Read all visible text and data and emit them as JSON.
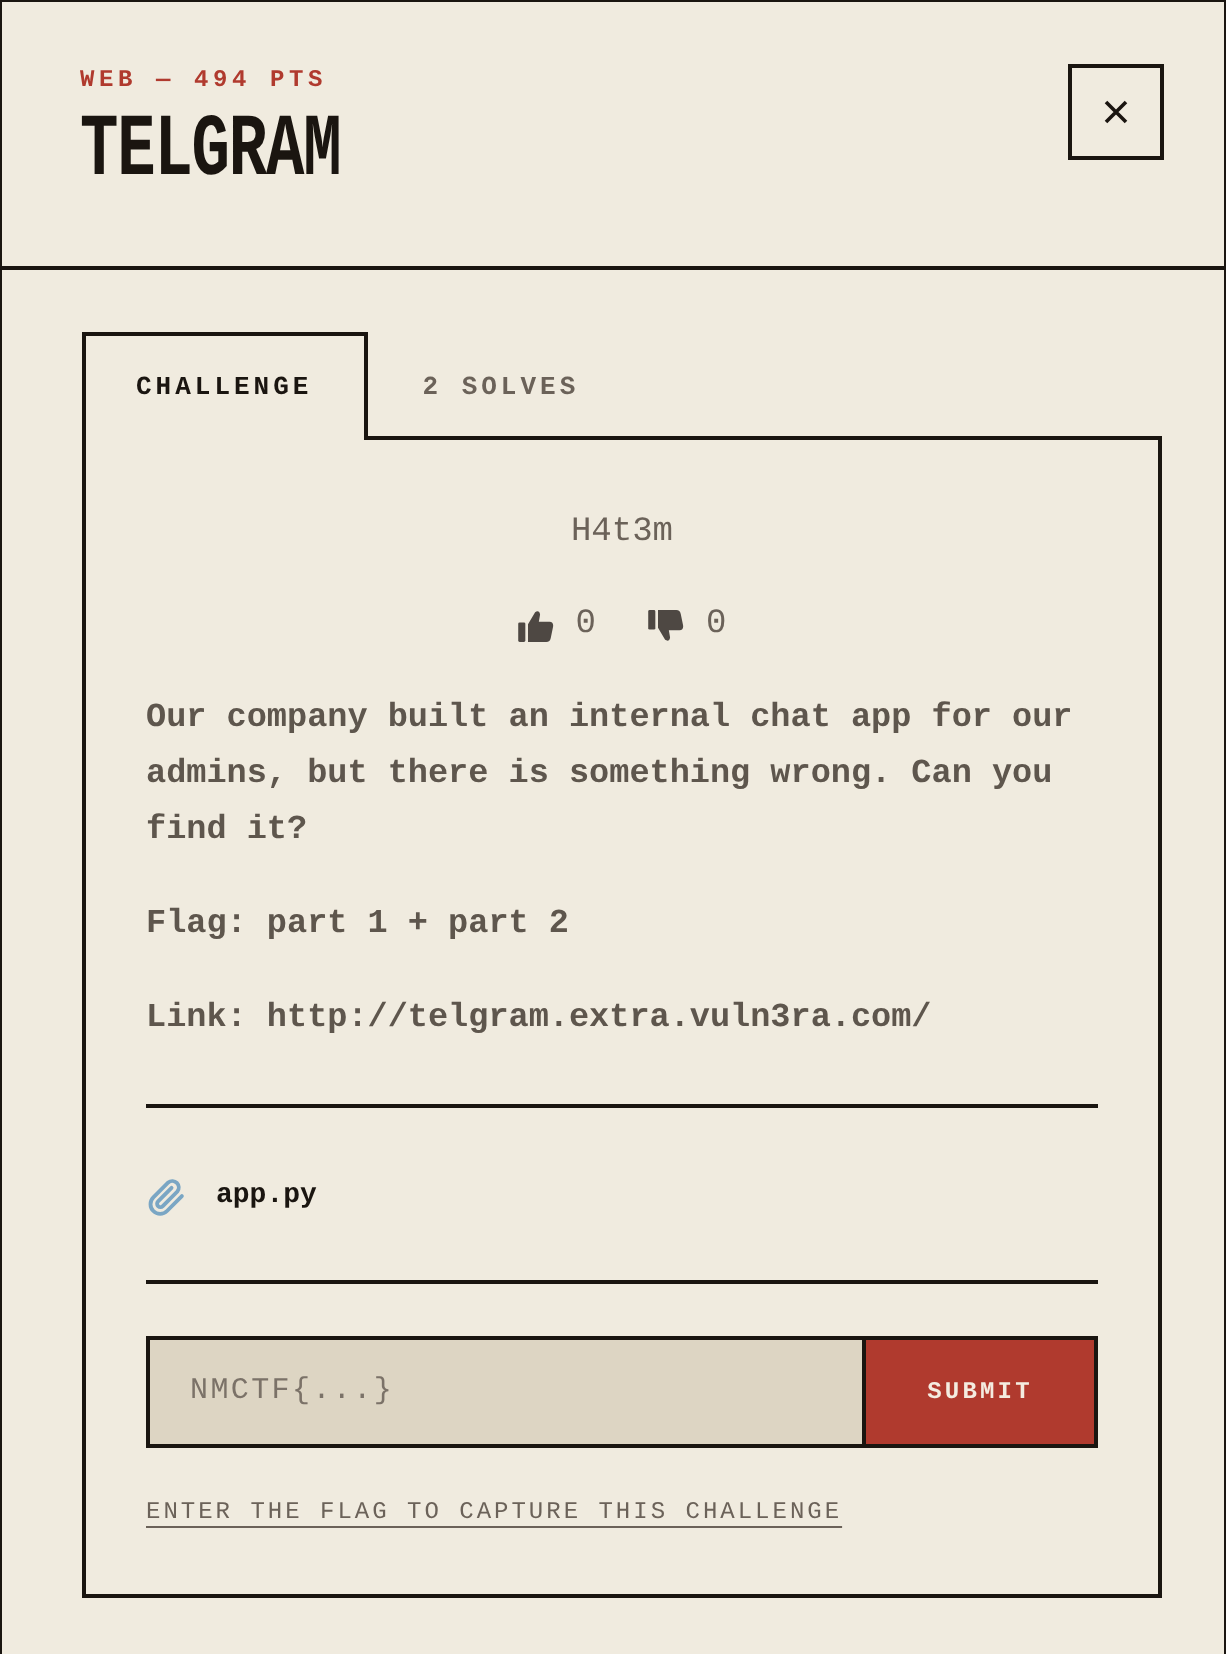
{
  "header": {
    "category": "WEB — 494 PTS",
    "title": "TELGRAM"
  },
  "tabs": [
    {
      "label": "CHALLENGE",
      "selected": true
    },
    {
      "label": "2 SOLVES",
      "selected": false
    }
  ],
  "challenge": {
    "author": "H4t3m",
    "votes": [
      {
        "kind": "up",
        "count": "0"
      },
      {
        "kind": "down",
        "count": "0"
      }
    ],
    "description": [
      "Our company built an internal chat app for our admins, but there is something wrong. Can you find it?",
      "Flag: part 1 + part 2",
      "Link: http://telgram.extra.vuln3ra.com/"
    ],
    "files": [
      {
        "name": "app.py"
      }
    ]
  },
  "flag_form": {
    "placeholder": "NMCTF{...}",
    "submit": "SUBMIT",
    "hint": "ENTER THE FLAG TO CAPTURE THIS CHALLENGE"
  }
}
